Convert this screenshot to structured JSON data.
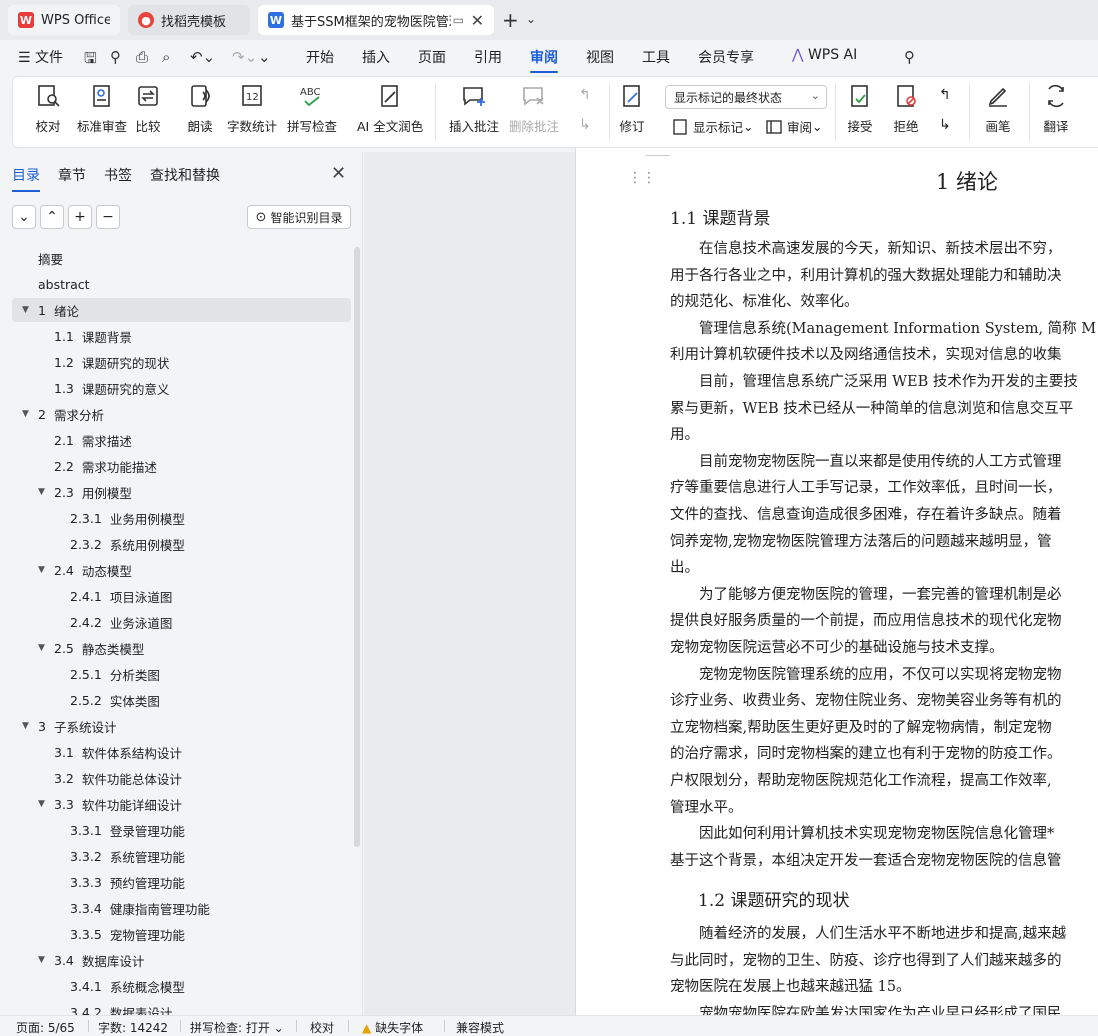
{
  "tabs": [
    {
      "label": "WPS Office",
      "icon": "wps-logo-icon"
    },
    {
      "label": "找稻壳模板",
      "icon": "daoke-icon"
    },
    {
      "label": "基于SSM框架的宠物医院管理",
      "icon": "word-doc-icon"
    }
  ],
  "menu": {
    "file": "文件",
    "items": [
      "开始",
      "插入",
      "页面",
      "引用",
      "审阅",
      "视图",
      "工具",
      "会员专享"
    ],
    "active": "审阅",
    "ai": "WPS AI"
  },
  "ribbon": {
    "buttons": {
      "proofread": "校对",
      "std_review": "标准审查",
      "compare": "比较",
      "read_aloud": "朗读",
      "word_count": "字数统计",
      "spell_check": "拼写检查",
      "ai_polish": "AI 全文润色",
      "insert_comment": "插入批注",
      "delete_comment": "删除批注",
      "track": "修订",
      "accept": "接受",
      "reject": "拒绝",
      "pen": "画笔",
      "translate": "翻译"
    },
    "markup_select": "显示标记的最终状态",
    "show_markup": "显示标记",
    "review": "审阅"
  },
  "panel": {
    "tabs": [
      "目录",
      "章节",
      "书签",
      "查找和替换"
    ],
    "active_tab": "目录",
    "smart_btn": "智能识别目录",
    "toc": [
      {
        "num": "",
        "title": "摘要",
        "level": 0,
        "arrow": ""
      },
      {
        "num": "",
        "title": "abstract",
        "level": 0,
        "arrow": ""
      },
      {
        "num": "1",
        "title": "绪论",
        "level": 0,
        "arrow": "▼",
        "active": true
      },
      {
        "num": "1.1",
        "title": "课题背景",
        "level": 1,
        "arrow": ""
      },
      {
        "num": "1.2",
        "title": "课题研究的现状",
        "level": 1,
        "arrow": ""
      },
      {
        "num": "1.3",
        "title": "课题研究的意义",
        "level": 1,
        "arrow": ""
      },
      {
        "num": "2",
        "title": "需求分析",
        "level": 0,
        "arrow": "▼"
      },
      {
        "num": "2.1",
        "title": "需求描述",
        "level": 1,
        "arrow": ""
      },
      {
        "num": "2.2",
        "title": "需求功能描述",
        "level": 1,
        "arrow": ""
      },
      {
        "num": "2.3",
        "title": "用例模型",
        "level": 1,
        "arrow": "▼"
      },
      {
        "num": "2.3.1",
        "title": "业务用例模型",
        "level": 2,
        "arrow": ""
      },
      {
        "num": "2.3.2",
        "title": "系统用例模型",
        "level": 2,
        "arrow": ""
      },
      {
        "num": "2.4",
        "title": "动态模型",
        "level": 1,
        "arrow": "▼"
      },
      {
        "num": "2.4.1",
        "title": "项目泳道图",
        "level": 2,
        "arrow": ""
      },
      {
        "num": "2.4.2",
        "title": "业务泳道图",
        "level": 2,
        "arrow": ""
      },
      {
        "num": "2.5",
        "title": "静态类模型",
        "level": 1,
        "arrow": "▼"
      },
      {
        "num": "2.5.1",
        "title": "分析类图",
        "level": 2,
        "arrow": ""
      },
      {
        "num": "2.5.2",
        "title": "实体类图",
        "level": 2,
        "arrow": ""
      },
      {
        "num": "3",
        "title": "子系统设计",
        "level": 0,
        "arrow": "▼"
      },
      {
        "num": "3.1",
        "title": "软件体系结构设计",
        "level": 1,
        "arrow": ""
      },
      {
        "num": "3.2",
        "title": "软件功能总体设计",
        "level": 1,
        "arrow": ""
      },
      {
        "num": "3.3",
        "title": "软件功能详细设计",
        "level": 1,
        "arrow": "▼"
      },
      {
        "num": "3.3.1",
        "title": "登录管理功能",
        "level": 2,
        "arrow": ""
      },
      {
        "num": "3.3.2",
        "title": "系统管理功能",
        "level": 2,
        "arrow": ""
      },
      {
        "num": "3.3.3",
        "title": "预约管理功能",
        "level": 2,
        "arrow": ""
      },
      {
        "num": "3.3.4",
        "title": "健康指南管理功能",
        "level": 2,
        "arrow": ""
      },
      {
        "num": "3.3.5",
        "title": "宠物管理功能",
        "level": 2,
        "arrow": ""
      },
      {
        "num": "3.4",
        "title": "数据库设计",
        "level": 1,
        "arrow": "▼"
      },
      {
        "num": "3.4.1",
        "title": "系统概念模型",
        "level": 2,
        "arrow": ""
      },
      {
        "num": "3.4.2",
        "title": "数据表设计",
        "level": 2,
        "arrow": ""
      }
    ]
  },
  "doc": {
    "h1": "1  绪论",
    "h2a": "1.1  课题背景",
    "h2b": "1.2  课题研究的现状",
    "lines_a": [
      "　　在信息技术高速发展的今天，新知识、新技术层出不穷，",
      "用于各行各业之中，利用计算机的强大数据处理能力和辅助决",
      "的规范化、标准化、效率化。",
      "　　管理信息系统(Management Information System, 简称 M",
      "利用计算机软硬件技术以及网络通信技术，实现对信息的收集",
      "　　目前，管理信息系统广泛采用 WEB 技术作为开发的主要技",
      "累与更新，WEB 技术已经从一种简单的信息浏览和信息交互平",
      "用。",
      "　　目前宠物宠物医院一直以来都是使用传统的人工方式管理",
      "疗等重要信息进行人工手写记录，工作效率低，且时间一长，",
      "文件的查找、信息查询造成很多困难，存在着许多缺点。随着",
      "饲养宠物,宠物宠物医院管理方法落后的问题越来越明显，管",
      "出。",
      "　　为了能够方便宠物医院的管理，一套完善的管理机制是必",
      "提供良好服务质量的一个前提，而应用信息技术的现代化宠物",
      "宠物宠物医院运营必不可少的基础设施与技术支撑。",
      "　　宠物宠物医院管理系统的应用，不仅可以实现将宠物宠物",
      "诊疗业务、收费业务、宠物住院业务、宠物美容业务等有机的",
      "立宠物档案,帮助医生更好更及时的了解宠物病情，制定宠物",
      "的治疗需求，同时宠物档案的建立也有利于宠物的防疫工作。",
      "户权限划分，帮助宠物医院规范化工作流程，提高工作效率,",
      "管理水平。",
      "　　因此如何利用计算机技术实现宠物宠物医院信息化管理*",
      "基于这个背景，本组决定开发一套适合宠物宠物医院的信息管"
    ],
    "lines_b": [
      "　　随着经济的发展，人们生活水平不断地进步和提高,越来越",
      "与此同时，宠物的卫生、防疫、诊疗也得到了人们越来越多的",
      "宠物医院在发展上也越来越迅猛 15。",
      "　　宠物宠物医院在欧美发达国家作为产业早已经形成了国民"
    ]
  },
  "status": {
    "page": "页面: 5/65",
    "words": "字数: 14242",
    "spell": "拼写检查: 打开",
    "proof": "校对",
    "font_missing": "缺失字体",
    "compat": "兼容模式"
  },
  "colors": {
    "accent": "#1f5fd6",
    "wps_red": "#e83b3b",
    "word_blue": "#2f6fe0"
  }
}
